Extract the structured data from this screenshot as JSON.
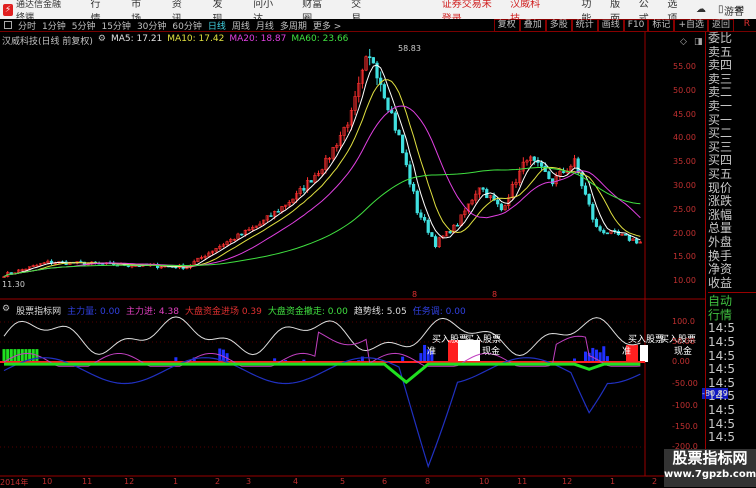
{
  "app": {
    "name": "通达信金融终端",
    "menus": [
      "行情",
      "市场",
      "资讯",
      "发现",
      "问小达",
      "财富圈",
      "交易"
    ],
    "login_status": "证券交易未登录",
    "stock_name": "汉威科技",
    "right_menus": [
      "功能",
      "版面",
      "公式",
      "选项"
    ],
    "user": "游客"
  },
  "periods": [
    "分时",
    "1分钟",
    "5分钟",
    "15分钟",
    "30分钟",
    "60分钟",
    "日线",
    "周线",
    "月线",
    "多周期",
    "更多 >"
  ],
  "active_period": "日线",
  "tools": [
    "复权",
    "叠加",
    "多股",
    "统计",
    "画线",
    "F10",
    "标记",
    "+自选",
    "返回"
  ],
  "tools_r": "R",
  "chart": {
    "title": "汉威科技(日线 前复权)",
    "ma5": "MA5: 17.21",
    "ma10": "MA10: 17.42",
    "ma20": "MA20: 18.87",
    "ma60": "MA60: 23.66",
    "high_label": "58.83",
    "low_label": "11.30",
    "marker": "8"
  },
  "price_axis": [
    "55.00",
    "50.00",
    "45.00",
    "40.00",
    "35.00",
    "30.00",
    "25.00",
    "20.00",
    "15.00",
    "10.00"
  ],
  "right_panel": [
    "委比",
    "卖五",
    "卖四",
    "卖三",
    "卖二",
    "卖一",
    "买一",
    "买二",
    "买三",
    "买四",
    "买五",
    "现价",
    "涨跌",
    "涨幅",
    "总量",
    "外盘",
    "换手",
    "净资",
    "收益"
  ],
  "right_panel2": [
    "自动",
    "行情",
    "14:5",
    "14:5",
    "14:5",
    "14:5",
    "14:5",
    "14:5",
    "14:5",
    "14:5",
    "14:5"
  ],
  "indicator": {
    "name": "股票指标网",
    "zl_in": "主力进: 4.38",
    "zl": "主力量: 0.00",
    "dp_in": "大盘资金进场 0.39",
    "dp_out": "大盘资金撤走: 0.00",
    "trend": "趋势线: 5.05",
    "extra": "任务调: 0.00",
    "axis": [
      "100.0",
      "50.00",
      "0.00",
      "-50.00",
      "-100.0",
      "-150.0",
      "-200.0"
    ],
    "current": "-80.89",
    "ann_buy": "买入股票",
    "ann_buy2": "买入股票",
    "ann_in": "准",
    "ann_cash": "现金"
  },
  "dates": [
    "2014年",
    "10",
    "11",
    "12",
    "1",
    "2",
    "3",
    "4",
    "5",
    "6",
    "8",
    "10",
    "11",
    "12",
    "1",
    "2"
  ],
  "watermark": {
    "line1": "股票指标网",
    "line2": "www.7gpzb.com"
  },
  "colors": {
    "up": "#ff3030",
    "down": "#40e0e0",
    "ma5": "#ffffff",
    "ma10": "#e0e040",
    "ma20": "#e040e0",
    "ma60": "#40e040"
  },
  "chart_data": {
    "type": "candlestick",
    "price_keypoints": [
      [
        0,
        11.3
      ],
      [
        12,
        14
      ],
      [
        30,
        13.5
      ],
      [
        50,
        13
      ],
      [
        58,
        17
      ],
      [
        70,
        22
      ],
      [
        80,
        28
      ],
      [
        88,
        35
      ],
      [
        95,
        45
      ],
      [
        100,
        58.83
      ],
      [
        104,
        50
      ],
      [
        108,
        40
      ],
      [
        113,
        25
      ],
      [
        118,
        18
      ],
      [
        124,
        22
      ],
      [
        130,
        30
      ],
      [
        136,
        25
      ],
      [
        143,
        36
      ],
      [
        150,
        31
      ],
      [
        156,
        35
      ],
      [
        162,
        21
      ],
      [
        175,
        18
      ]
    ],
    "ylim": [
      8,
      60
    ],
    "indicator_ylim": [
      -200,
      120
    ]
  }
}
